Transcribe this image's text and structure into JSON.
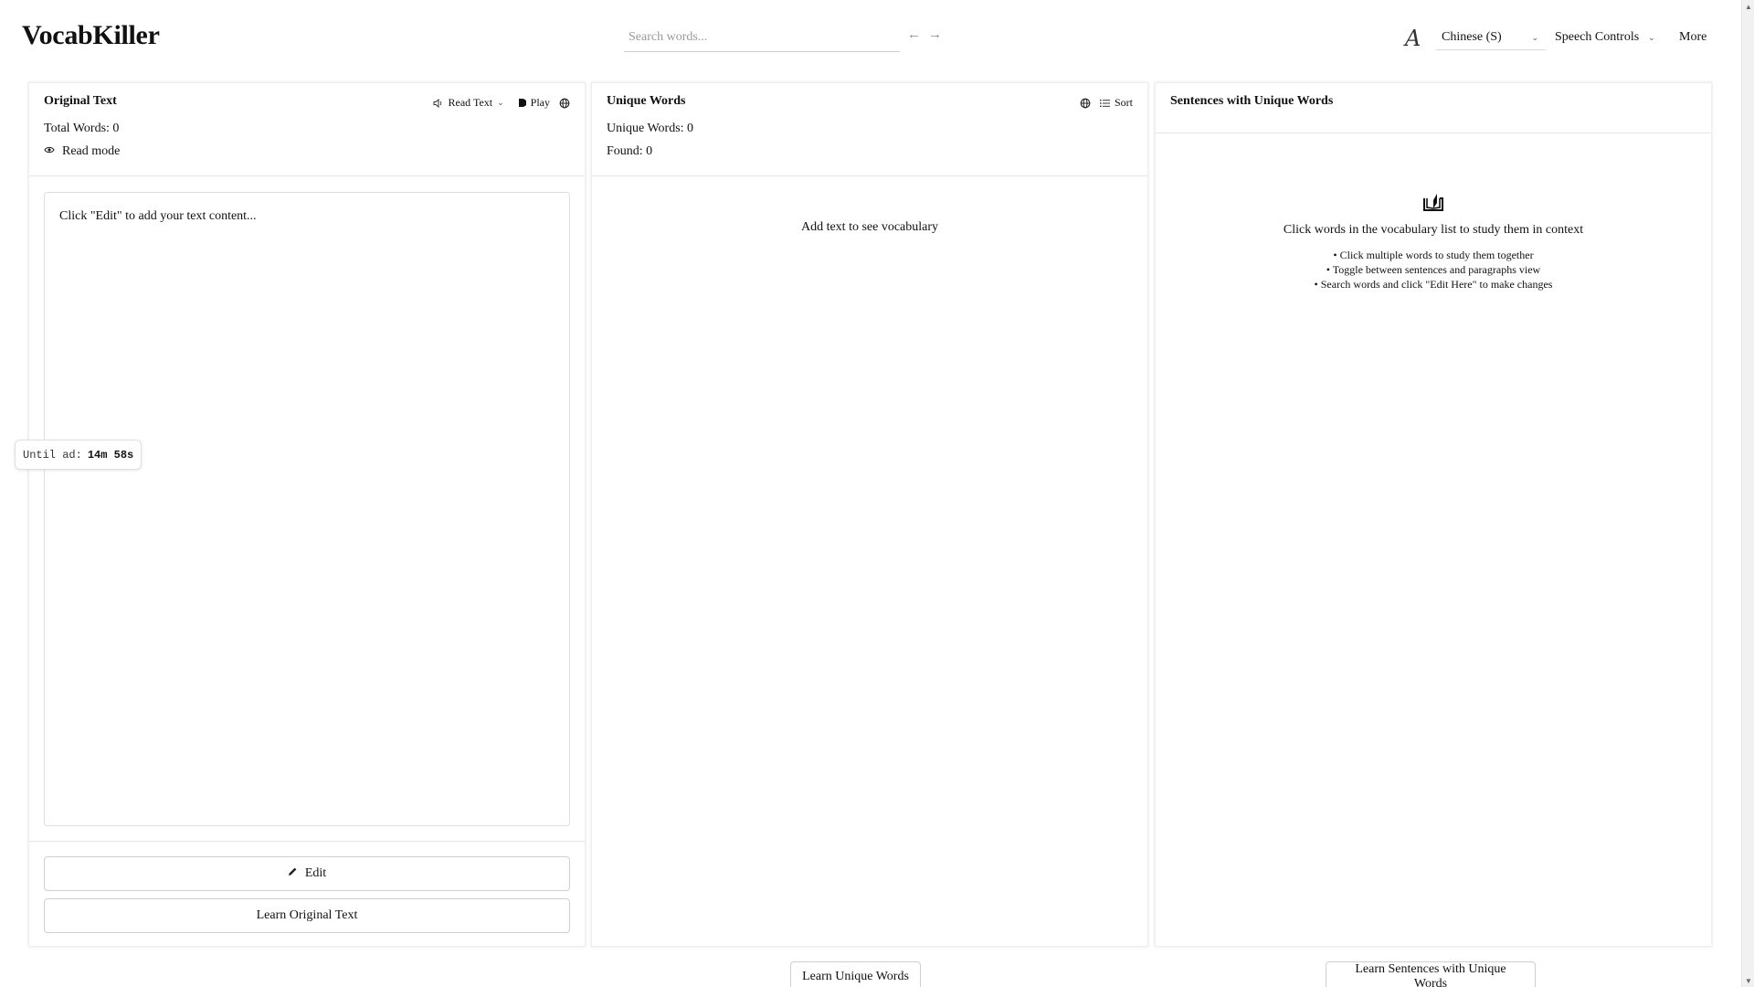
{
  "app": {
    "title": "VocabKiller"
  },
  "header": {
    "search_placeholder": "Search words...",
    "arrow_back": "←",
    "arrow_forward": "→",
    "font_icon_glyph": "A",
    "language": "Chinese (S)",
    "speech_controls": "Speech Controls",
    "more": "More"
  },
  "original": {
    "title": "Original Text",
    "read_text": "Read Text",
    "play": "Play",
    "total_words": "Total Words: 0",
    "read_mode": "Read mode",
    "placeholder": "Click \"Edit\" to add your text content...",
    "edit_button": "Edit",
    "learn_button": "Learn Original Text"
  },
  "unique": {
    "title": "Unique Words",
    "sort": "Sort",
    "unique_count": "Unique Words: 0",
    "found": "Found: 0",
    "empty": "Add text to see vocabulary",
    "learn_button": "Learn Unique Words"
  },
  "sentences": {
    "title": "Sentences with Unique Words",
    "hint_title": "Click words in the vocabulary list to study them in context",
    "hints": [
      "• Click multiple words to study them together",
      "• Toggle between sentences and paragraphs view",
      "• Search words and click \"Edit Here\" to make changes"
    ],
    "learn_button": "Learn Sentences with Unique Words"
  },
  "ad_timer": {
    "label": "Until ad:",
    "value": "14m 58s"
  },
  "icons": {
    "speaker": "speaker-icon",
    "play": "play-icon",
    "globe": "globe-icon",
    "eye": "eye-icon",
    "list": "list-icon",
    "pencil": "pencil-icon",
    "book": "open-book-icon"
  }
}
